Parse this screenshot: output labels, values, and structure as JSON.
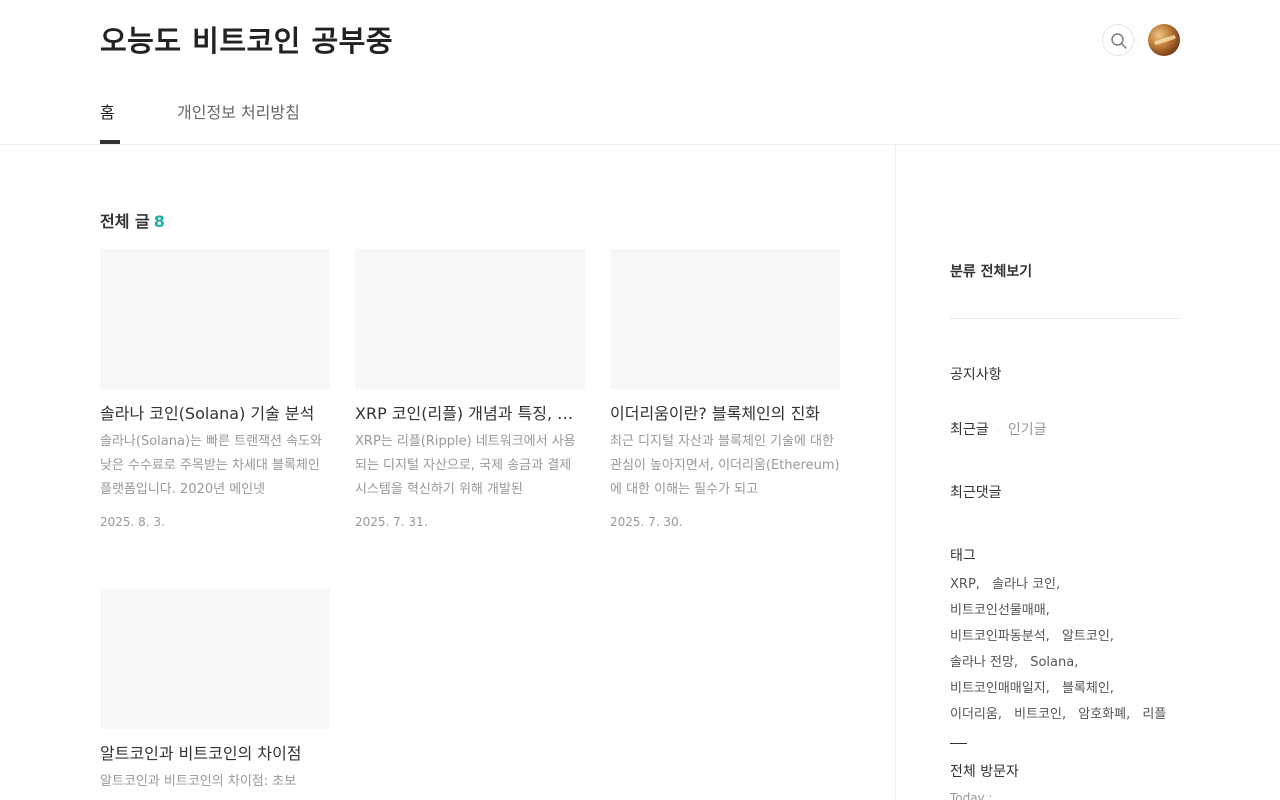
{
  "site": {
    "title": "오능도 비트코인 공부중"
  },
  "nav": {
    "items": [
      "홈",
      "개인정보 처리방침"
    ]
  },
  "main": {
    "section_label": "전체 글",
    "post_count": "8",
    "posts": [
      {
        "title": "솔라나 코인(Solana) 기술 분석",
        "summary": "솔라나(Solana)는 빠른 트랜잭션 속도와 낮은 수수료로 주목받는 차세대 블록체인 플랫폼입니다. 2020년 메인넷",
        "date": "2025. 8. 3."
      },
      {
        "title": "XRP 코인(리플) 개념과 특징, 전망",
        "summary": "XRP는 리플(Ripple) 네트워크에서 사용되는 디지털 자산으로, 국제 송금과 결제 시스템을 혁신하기 위해 개발된",
        "date": "2025. 7. 31."
      },
      {
        "title": "이더리움이란? 블록체인의 진화",
        "summary": "최근 디지털 자산과 블록체인 기술에 대한 관심이 높아지면서, 이더리움(Ethereum)에 대한 이해는 필수가 되고",
        "date": "2025. 7. 30."
      },
      {
        "title": "알트코인과 비트코인의 차이점",
        "summary": "알트코인과 비트코인의 차이점: 초보",
        "date": ""
      }
    ]
  },
  "sidebar": {
    "category_all": "분류 전체보기",
    "notice": "공지사항",
    "recent_tab": "최근글",
    "popular_tab": "인기글",
    "recent_comments": "최근댓글",
    "tags_heading": "태그",
    "tags": [
      "XRP,",
      "솔라나 코인,",
      "비트코인선물매매,",
      "비트코인파동분석,",
      "알트코인,",
      "솔라나 전망,",
      "Solana,",
      "비트코인매매일지,",
      "블록체인,",
      "이더리움,",
      "비트코인,",
      "암호화폐,",
      "리플"
    ],
    "visitors_heading": "전체 방문자",
    "today_label": "Today :"
  },
  "icons": {
    "search": "search-icon",
    "avatar": "blog-avatar"
  },
  "colors": {
    "accent": "#1bb1a7",
    "text": "#333333",
    "muted": "#999999"
  }
}
